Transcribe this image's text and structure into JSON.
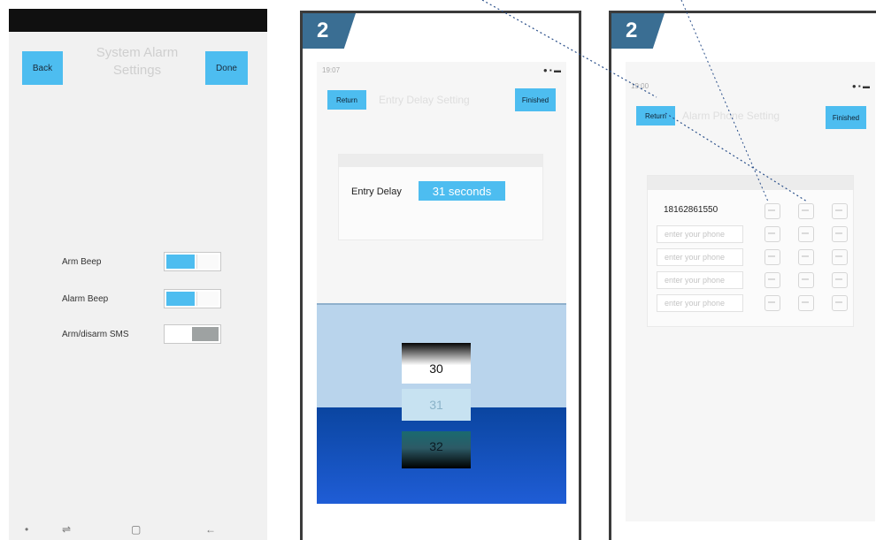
{
  "phone1": {
    "status_left": "",
    "status_right": "",
    "back_label": "Back",
    "done_label": "Done",
    "title": "System Alarm Settings",
    "toggles": [
      {
        "label": "Arm Beep",
        "state": "on"
      },
      {
        "label": "Alarm Beep",
        "state": "on"
      },
      {
        "label": "Arm/disarm SMS",
        "state": "off"
      }
    ],
    "nav": [
      "•",
      "⇌",
      "▢",
      "←"
    ]
  },
  "step_badge_1": "2",
  "step_badge_2": "2",
  "phone2": {
    "time": "19:07",
    "status_right": "● ▪ ▬",
    "return_label": "Return",
    "title": "Entry Delay Setting",
    "finished_label": "Finished",
    "entry_delay_label": "Entry Delay",
    "entry_delay_value": "31 seconds",
    "picker": [
      "30",
      "31",
      "32"
    ]
  },
  "phone3": {
    "time": "19:00",
    "status_right": "● ▪ ▬",
    "return_label": "Return",
    "title": "Alarm Phone Setting",
    "finished_label": "Finished",
    "phones": [
      {
        "value": "18162861550",
        "placeholder": ""
      },
      {
        "value": "",
        "placeholder": "enter your phone"
      },
      {
        "value": "",
        "placeholder": "enter your phone"
      },
      {
        "value": "",
        "placeholder": "enter your phone"
      },
      {
        "value": "",
        "placeholder": "enter your phone"
      }
    ]
  },
  "colors": {
    "accent": "#4dbdf0",
    "badge": "#3a6e93",
    "picker_light": "#b9d4ec",
    "picker_dark": "#0a45a0"
  }
}
